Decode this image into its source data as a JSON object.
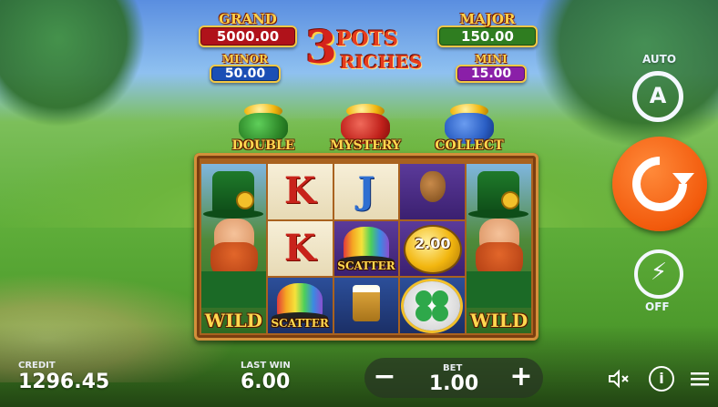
{
  "jackpots": {
    "grand": {
      "label": "GRAND",
      "value": "5000.00",
      "color": "#b0121a"
    },
    "major": {
      "label": "MAJOR",
      "value": "150.00",
      "color": "#2f7d20"
    },
    "minor": {
      "label": "MINOR",
      "value": "50.00",
      "color": "#1b4fb5"
    },
    "mini": {
      "label": "MINI",
      "value": "15.00",
      "color": "#8a1fa8"
    }
  },
  "logo": {
    "number": "3",
    "line1": "POTS",
    "line2": "RICHES"
  },
  "pots": [
    {
      "label": "DOUBLE",
      "color": "#2f8a2a"
    },
    {
      "label": "MYSTERY",
      "color": "#c0211b"
    },
    {
      "label": "COLLECT",
      "color": "#2a5ec4"
    }
  ],
  "reels": {
    "wild_label": "WILD",
    "scatter_label": "SCATTER",
    "letters": {
      "k": "K",
      "j": "J"
    },
    "coin_value": "2.00"
  },
  "controls": {
    "auto_label": "AUTO",
    "auto_letter": "A",
    "turbo_state": "OFF"
  },
  "footer": {
    "credit_label": "CREDIT",
    "credit_value": "1296.45",
    "last_win_label": "LAST WIN",
    "last_win_value": "6.00",
    "bet_label": "BET",
    "bet_value": "1.00",
    "minus": "−",
    "plus": "+"
  },
  "icons": {
    "mute": "speaker-muted-icon",
    "info": "info-icon",
    "menu": "hamburger-menu-icon"
  },
  "colors": {
    "spin_orange": "#f25a0c",
    "frame_wood": "#a9621f"
  }
}
